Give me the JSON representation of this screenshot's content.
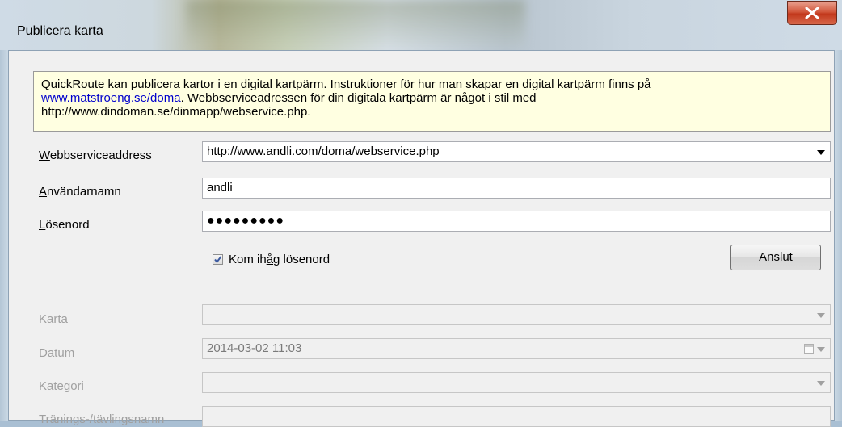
{
  "window": {
    "title": "Publicera karta",
    "close_glyph": "X"
  },
  "info": {
    "text_1": "QuickRoute kan publicera kartor i en digital kartpärm. Instruktioner för hur man skapar en digital kartpärm finns på",
    "link": "www.matstroeng.se/doma",
    "text_2": ". Webbserviceadressen för din digitala kartpärm är något i stil med",
    "text_3": "http://www.dindoman.se/dinmapp/webservice.php."
  },
  "form": {
    "webservice": {
      "label_u": "W",
      "label_rest": "ebbserviceaddress",
      "value": "http://www.andli.com/doma/webservice.php"
    },
    "username": {
      "label_u": "A",
      "label_rest": "nvändarnamn",
      "value": "andli"
    },
    "password": {
      "label_u": "L",
      "label_rest": "ösenord",
      "value": "●●●●●●●●●"
    },
    "remember": {
      "label_pre": "Kom ih",
      "label_u": "å",
      "label_post": "g lösenord",
      "checked": true
    },
    "connect": {
      "label_pre": "Ansl",
      "label_u": "u",
      "label_post": "t"
    },
    "map": {
      "label_u": "K",
      "label_rest": "arta",
      "value": ""
    },
    "date": {
      "label_u": "D",
      "label_rest": "atum",
      "value": "2014-03-02 11:03"
    },
    "category": {
      "label_pre": "Katego",
      "label_u": "r",
      "label_post": "i",
      "value": ""
    },
    "event_name": {
      "label": "Tränings-/tävlingsnamn",
      "value": ""
    }
  },
  "colors": {
    "link": "#0000cc",
    "info_bg": "#ffffe1",
    "close": "#c2381c"
  }
}
